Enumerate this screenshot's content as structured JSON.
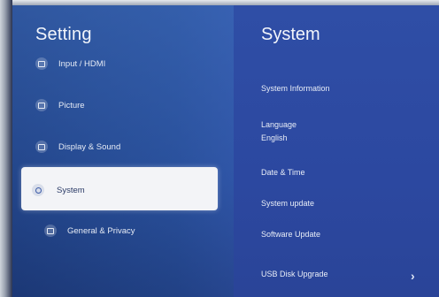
{
  "left_title": "Setting",
  "right_title": "System",
  "menu": [
    {
      "label": "Input / HDMI",
      "icon": "input-icon"
    },
    {
      "label": "Picture",
      "icon": "picture-icon"
    },
    {
      "label": "Display & Sound",
      "icon": "display-sound-icon"
    },
    {
      "label": "System",
      "icon": "system-icon",
      "selected": true
    },
    {
      "label": "General & Privacy",
      "icon": "general-privacy-icon"
    }
  ],
  "system_settings": {
    "system_information": "System Information",
    "language_label": "Language",
    "language_value": "English",
    "date_time": "Date & Time",
    "system_update": "System update",
    "software_update": "Software Update",
    "usb_disk_upgrade": "USB Disk Upgrade",
    "chevron": "›"
  },
  "colors": {
    "selected_bg": "#f3f4f7",
    "text": "#e8edf7",
    "panel": "#2f4ea6"
  }
}
